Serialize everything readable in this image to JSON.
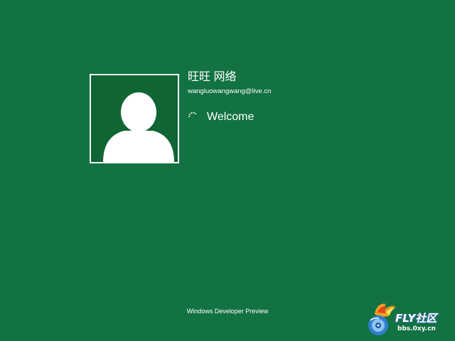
{
  "colors": {
    "background": "#127241",
    "avatar_background": "#0f6534",
    "foreground": "#ffffff"
  },
  "user": {
    "name": "旺旺 网络",
    "email": "wangluowangwang@live.cn",
    "avatar_icon": "user-silhouette-icon"
  },
  "status": {
    "spinner_icon": "loading-spinner-icon",
    "message": "Welcome"
  },
  "footer": {
    "label": "Windows Developer Preview"
  },
  "watermark": {
    "logo_icon": "fly-logo-icon",
    "brand": "FLY社区",
    "url": "bbs.0xy.cn"
  }
}
